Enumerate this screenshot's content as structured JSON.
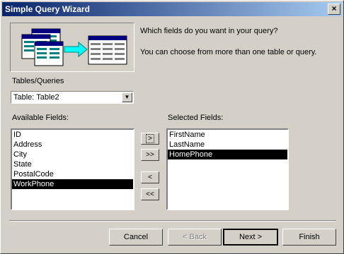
{
  "window": {
    "title": "Simple Query Wizard",
    "close_glyph": "×"
  },
  "prompt": {
    "question": "Which fields do you want in your query?",
    "note": "You can choose from more than one table or query."
  },
  "tables_queries": {
    "label": "Tables/Queries",
    "selected": "Table: Table2"
  },
  "available": {
    "label": "Available Fields:",
    "items": [
      "ID",
      "Address",
      "City",
      "State",
      "PostalCode",
      "WorkPhone"
    ],
    "selected_index": 5
  },
  "selected": {
    "label": "Selected Fields:",
    "items": [
      "FirstName",
      "LastName",
      "HomePhone"
    ],
    "selected_index": 2
  },
  "move_buttons": {
    "add_one": ">",
    "add_all": ">>",
    "remove_one": "<",
    "remove_all": "<<"
  },
  "buttons": {
    "cancel": "Cancel",
    "back": "< Back",
    "next": "Next >",
    "finish": "Finish"
  },
  "colors": {
    "face": "#d4d0c8",
    "title_start": "#0a246a",
    "title_end": "#a6caf0",
    "selection": "#000000"
  },
  "icons": {
    "illustration": "tables-to-query-icon"
  }
}
